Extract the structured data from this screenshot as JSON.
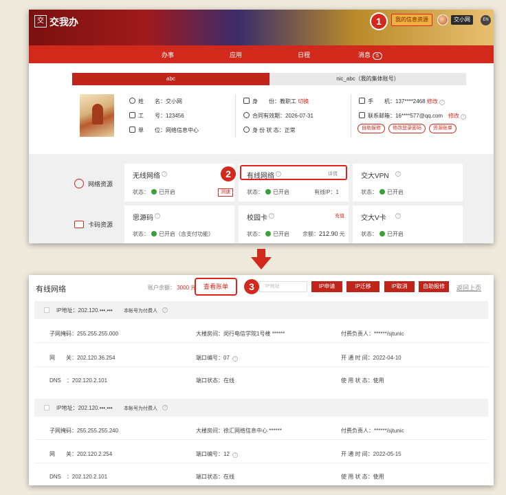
{
  "header": {
    "logo_glyph": "交",
    "logo_text": "交我办",
    "my_info_button": "我的信息资源",
    "user_name": "交小网",
    "lang": "EN"
  },
  "nav": {
    "items": [
      "办事",
      "应用",
      "日程",
      "消息"
    ],
    "message_count": "5"
  },
  "tabs": [
    "abc",
    "nic_abc（我的集体账号）"
  ],
  "profile": {
    "name_label": "姓　　名：",
    "name": "交小网",
    "id_label": "工　　号：",
    "id": "123456",
    "unit_label": "单　　位：",
    "unit": "网络信息中心",
    "identity_label": "身　　份：",
    "identity": "教职工",
    "switch": "切换",
    "contract_label": "合同有效期：",
    "contract": "2026-07-31",
    "status_label": "身 份 状 态：",
    "status": "正常",
    "phone_label": "手　　机：",
    "phone": "137****2468",
    "edit": "修改",
    "email_label": "联系邮箱：",
    "email": "16****577@qq.com",
    "actions": [
      "自助报修",
      "修改登录密码",
      "资源账单"
    ]
  },
  "resources": {
    "network_label": "网络资源",
    "card_label": "卡码资源",
    "cards": [
      {
        "title": "无线网络",
        "status_label": "状态：",
        "status": "已开启",
        "tag": "测速"
      },
      {
        "title": "有线网络",
        "status_label": "状态：",
        "status": "已开启",
        "detail": "详情",
        "extra": "有线IP：1"
      },
      {
        "title": "交大VPN",
        "status_label": "状态：",
        "status": "已开启"
      },
      {
        "title": "思源码",
        "status_label": "状态：",
        "status": "已开启（含支付功能）"
      },
      {
        "title": "校园卡",
        "status_label": "状态：",
        "status": "已开启",
        "detail": "充值",
        "extra": "余额：",
        "balance": "212.90",
        "unit": "元"
      },
      {
        "title": "交大V卡",
        "status_label": "状态：",
        "status": "已开启"
      }
    ]
  },
  "markers": [
    "1",
    "2",
    "3"
  ],
  "wired": {
    "title": "有线网络",
    "balance_label": "账户余额：",
    "balance": "3000",
    "balance_unit": "元",
    "view_bill": "查看账单",
    "search_placeholder": "IP地址",
    "buttons": [
      "IP申请",
      "IP迁移",
      "IP取消",
      "自助报修"
    ],
    "back": "返回上页",
    "groups": [
      {
        "ip_label": "IP地址：",
        "ip": "202.120.•••.•••",
        "payer_note": "本帐号为付费人",
        "mask_label": "子网掩码：",
        "mask": "255.255.255.000",
        "building_label": "大楼房间：",
        "building": "闵行电信学院1号楼 ******",
        "payer_label": "付费负责人：",
        "payer": "******/sjtunic",
        "gw_label": "网　　关：",
        "gw": "202.120.36.254",
        "port_label": "端口编号：",
        "port": "07",
        "open_label": "开 通 时 间：",
        "open": "2022-04-10",
        "dns_label": "DNS　：",
        "dns": "202.120.2.101",
        "port_status_label": "端口状态：",
        "port_status": "在线",
        "use_label": "使 用 状 态：",
        "use": "使用"
      },
      {
        "ip_label": "IP地址：",
        "ip": "202.120.•••.•••",
        "payer_note": "本帐号为付费人",
        "mask_label": "子网掩码：",
        "mask": "255.255.255.240",
        "building_label": "大楼房间：",
        "building": "徐汇网络信息中心 ******",
        "payer_label": "付费负责人：",
        "payer": "******/sjtunic",
        "gw_label": "网　　关：",
        "gw": "202.120.2.254",
        "port_label": "端口编号：",
        "port": "12",
        "open_label": "开 通 时 间：",
        "open": "2022-05-15",
        "dns_label": "DNS　：",
        "dns": "202.120.2.101",
        "port_status_label": "端口状态：",
        "port_status": "在线",
        "use_label": "使 用 状 态：",
        "use": "使用"
      }
    ]
  },
  "colors": {
    "accent": "#d12a1d",
    "ok": "#3aa03a"
  }
}
